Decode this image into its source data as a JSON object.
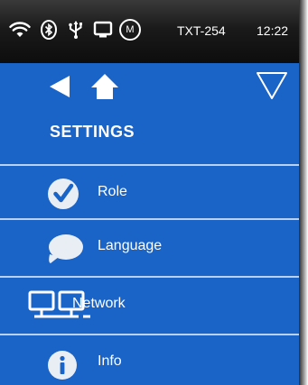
{
  "statusbar": {
    "device_name": "TXT-254",
    "time": "12:22",
    "icons": [
      "wifi-icon",
      "bluetooth-icon",
      "usb-icon",
      "display-icon",
      "m-circle-icon"
    ],
    "m_label": "M"
  },
  "header": {
    "title": "SETTINGS",
    "icons": [
      "back-arrow-icon",
      "home-icon",
      "dropdown-triangle-icon"
    ]
  },
  "menu": {
    "items": [
      {
        "label": "Role",
        "icon": "checkmark-circle-icon"
      },
      {
        "label": "Language",
        "icon": "speech-bubble-icon"
      },
      {
        "label": "Network",
        "icon": "network-monitors-icon"
      },
      {
        "label": "Info",
        "icon": "info-circle-icon"
      }
    ]
  },
  "colors": {
    "background": "#1a63c7",
    "divider": "#b9d2f3",
    "statusbar": "#1a1a1a",
    "text": "#ffffff"
  }
}
